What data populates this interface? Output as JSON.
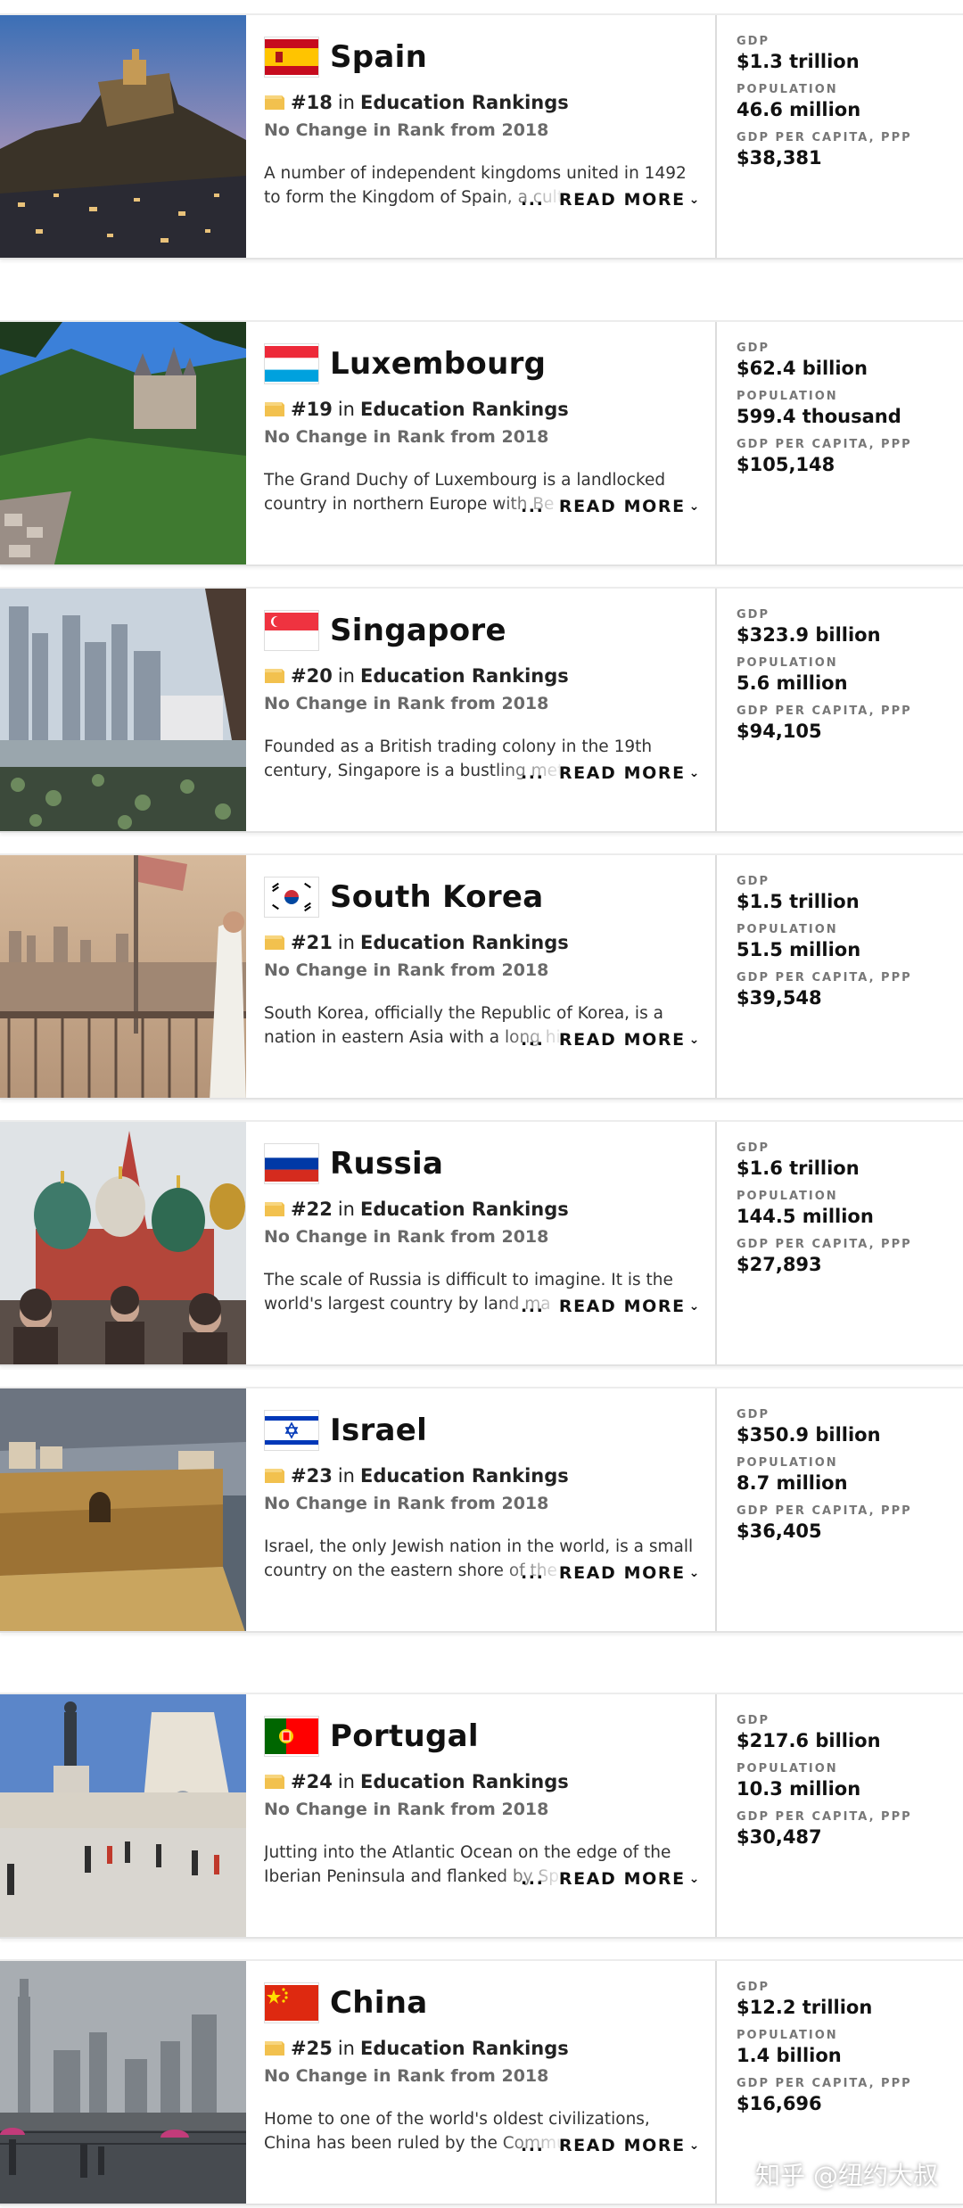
{
  "accent_colors": {
    "rank_icon": "#f2c14e",
    "label_gray": "#777777",
    "subtle_gray": "#6a6a6a"
  },
  "labels": {
    "in": "in",
    "gdp": "GDP",
    "population": "POPULATION",
    "gdp_per_capita": "GDP PER CAPITA, PPP",
    "read_more": "READ MORE",
    "ellipsis": "..."
  },
  "countries": [
    {
      "name": "Spain",
      "flag_icon": "spain-flag-icon",
      "photo": "castle-on-cliff-at-dusk",
      "rank": "#18",
      "category": "Education Rankings",
      "rank_change": "No Change in Rank from 2018",
      "description": "A number of independent kingdoms united in 1492 to form the Kingdom of Spain, a cultu",
      "gdp": "$1.3 trillion",
      "population": "46.6 million",
      "gdp_per_capita": "$38,381"
    },
    {
      "name": "Luxembourg",
      "flag_icon": "luxembourg-flag-icon",
      "photo": "castle-on-wooded-hill",
      "rank": "#19",
      "category": "Education Rankings",
      "rank_change": "No Change in Rank from 2018",
      "description": "The Grand Duchy of Luxembourg is a landlocked country in northern Europe with Be",
      "gdp": "$62.4 billion",
      "population": "599.4 thousand",
      "gdp_per_capita": "$105,148"
    },
    {
      "name": "Singapore",
      "flag_icon": "singapore-flag-icon",
      "photo": "city-skyline-over-water",
      "rank": "#20",
      "category": "Education Rankings",
      "rank_change": "No Change in Rank from 2018",
      "description": "Founded as a British trading colony in the 19th century, Singapore is a bustling metropolis",
      "gdp": "$323.9 billion",
      "population": "5.6 million",
      "gdp_per_capita": "$94,105"
    },
    {
      "name": "South Korea",
      "flag_icon": "south-korea-flag-icon",
      "photo": "river-bridge-at-sunset",
      "rank": "#21",
      "category": "Education Rankings",
      "rank_change": "No Change in Rank from 2018",
      "description": "South Korea, officially the Republic of Korea, is a nation in eastern Asia with a long history",
      "gdp": "$1.5 trillion",
      "population": "51.5 million",
      "gdp_per_capita": "$39,548"
    },
    {
      "name": "Russia",
      "flag_icon": "russia-flag-icon",
      "photo": "onion-domed-cathedral",
      "rank": "#22",
      "category": "Education Rankings",
      "rank_change": "No Change in Rank from 2018",
      "description": "The scale of Russia is difficult to imagine. It is the world's largest country by land ma",
      "gdp": "$1.6 trillion",
      "population": "144.5 million",
      "gdp_per_capita": "$27,893"
    },
    {
      "name": "Israel",
      "flag_icon": "israel-flag-icon",
      "photo": "stone-seawall-old-town",
      "rank": "#23",
      "category": "Education Rankings",
      "rank_change": "No Change in Rank from 2018",
      "description": "Israel, the only Jewish nation in the world, is a small country on the eastern shore of the",
      "gdp": "$350.9 billion",
      "population": "8.7 million",
      "gdp_per_capita": "$36,405"
    },
    {
      "name": "Portugal",
      "flag_icon": "portugal-flag-icon",
      "photo": "statue-and-arch-plaza",
      "rank": "#24",
      "category": "Education Rankings",
      "rank_change": "No Change in Rank from 2018",
      "description": "Jutting into the Atlantic Ocean on the edge of the Iberian Peninsula and flanked by Sp",
      "gdp": "$217.6 billion",
      "population": "10.3 million",
      "gdp_per_capita": "$30,487"
    },
    {
      "name": "China",
      "flag_icon": "china-flag-icon",
      "photo": "misty-city-waterfront",
      "rank": "#25",
      "category": "Education Rankings",
      "rank_change": "No Change in Rank from 2018",
      "description": "Home to one of the world's oldest civilizations, China has been ruled by the Communist Pa",
      "gdp": "$12.2 trillion",
      "population": "1.4 billion",
      "gdp_per_capita": "$16,696"
    }
  ],
  "watermark": "知乎 @纽约大叔"
}
